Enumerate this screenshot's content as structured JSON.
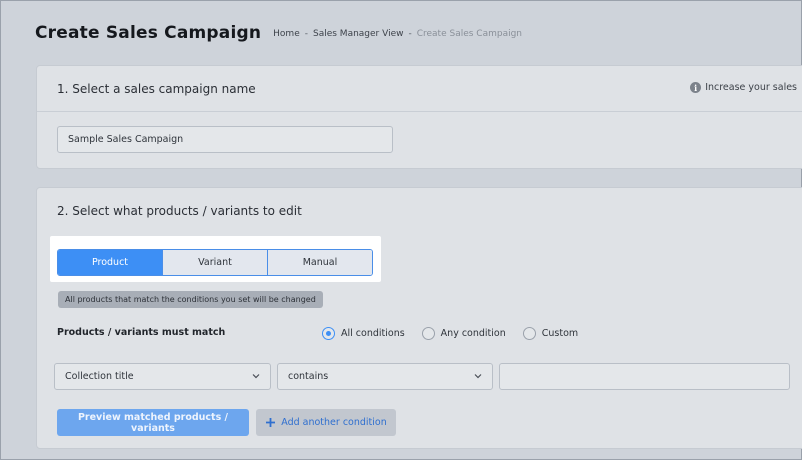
{
  "header": {
    "title": "Create Sales Campaign",
    "breadcrumb": {
      "items": [
        "Home",
        "Sales Manager View"
      ],
      "current": "Create Sales Campaign",
      "separator": "-"
    }
  },
  "step1": {
    "title": "1. Select a sales campaign name",
    "hint": "Increase your sales",
    "hint_icon": "info-icon",
    "campaign_name": "Sample Sales Campaign"
  },
  "step2": {
    "title": "2. Select what products / variants to edit",
    "tabs": [
      {
        "label": "Product",
        "active": true
      },
      {
        "label": "Variant",
        "active": false
      },
      {
        "label": "Manual",
        "active": false
      }
    ],
    "notice": "All products that match the conditions you set will be changed",
    "match_label": "Products / variants must match",
    "match_options": [
      {
        "label": "All conditions",
        "checked": true
      },
      {
        "label": "Any condition",
        "checked": false
      },
      {
        "label": "Custom",
        "checked": false
      }
    ],
    "condition": {
      "field": "Collection title",
      "operator": "contains",
      "value": ""
    },
    "preview_label": "Preview matched products / variants",
    "add_condition_label": "Add another condition"
  },
  "colors": {
    "accent": "#3d8ff5",
    "background": "#ced3da",
    "card": "#dfe2e6"
  }
}
